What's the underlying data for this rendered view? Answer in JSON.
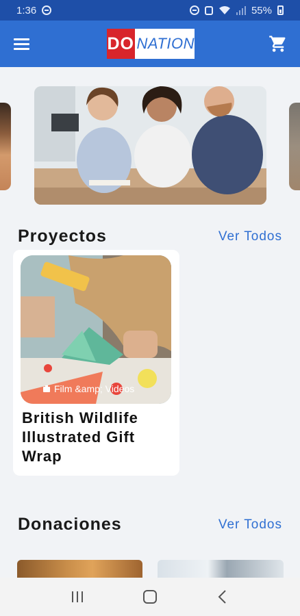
{
  "status_bar": {
    "time": "1:36",
    "battery": "55%"
  },
  "app_bar": {
    "logo_do": "DO",
    "logo_nation": "NATION"
  },
  "projects": {
    "title": "Proyectos",
    "see_all": "Ver Todos",
    "items": [
      {
        "category": "Film &amp; Videos",
        "title": "British Wildlife Illustrated Gift Wrap"
      }
    ]
  },
  "donations": {
    "title": "Donaciones",
    "see_all": "Ver Todos"
  },
  "colors": {
    "primary": "#2f6fd2",
    "status_bar": "#1e4fa8",
    "logo_red": "#d8252b",
    "background": "#f1f3f6"
  },
  "icons": [
    "menu-icon",
    "cart-icon",
    "camera-icon",
    "recent-apps-icon",
    "home-icon",
    "back-icon"
  ]
}
